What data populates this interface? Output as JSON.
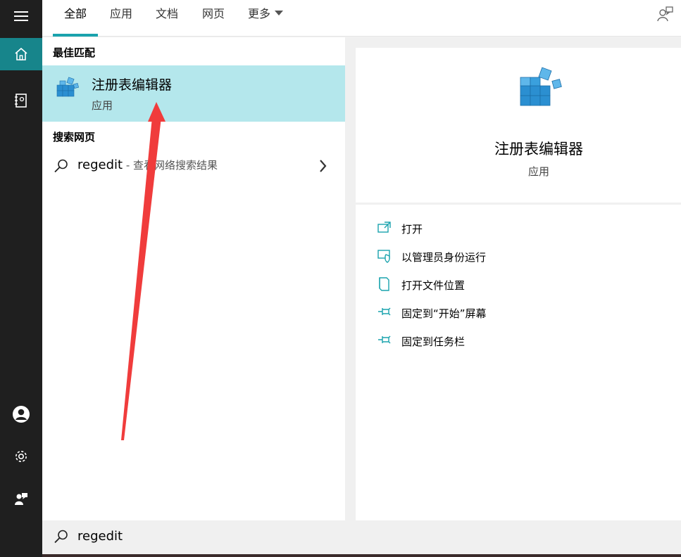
{
  "tabs": [
    {
      "label": "全部",
      "active": true
    },
    {
      "label": "应用",
      "active": false
    },
    {
      "label": "文档",
      "active": false
    },
    {
      "label": "网页",
      "active": false
    },
    {
      "label": "更多",
      "active": false
    }
  ],
  "rail": {
    "items": [
      "menu-icon",
      "home-icon",
      "notebook-icon",
      "account-icon",
      "settings-icon",
      "feedback-person-icon"
    ]
  },
  "results": {
    "best_match_title": "最佳匹配",
    "best_match": {
      "name": "注册表编辑器",
      "type": "应用",
      "icon": "registry-editor-icon"
    },
    "web_title": "搜索网页",
    "web_item": {
      "query": "regedit",
      "hint": " - 查看网络搜索结果"
    }
  },
  "preview": {
    "name": "注册表编辑器",
    "type": "应用",
    "actions": [
      {
        "label": "打开",
        "icon": "open-icon"
      },
      {
        "label": "以管理员身份运行",
        "icon": "run-as-admin-icon"
      },
      {
        "label": "打开文件位置",
        "icon": "file-location-icon"
      },
      {
        "label": "固定到“开始”屏幕",
        "icon": "pin-icon"
      },
      {
        "label": "固定到任务栏",
        "icon": "pin-icon"
      }
    ]
  },
  "search": {
    "value": "regedit"
  },
  "colors": {
    "accent": "#1aa3ad",
    "selection": "#b4e7ec",
    "rail": "#1f1f1f",
    "arrow": "#f03c3c"
  }
}
